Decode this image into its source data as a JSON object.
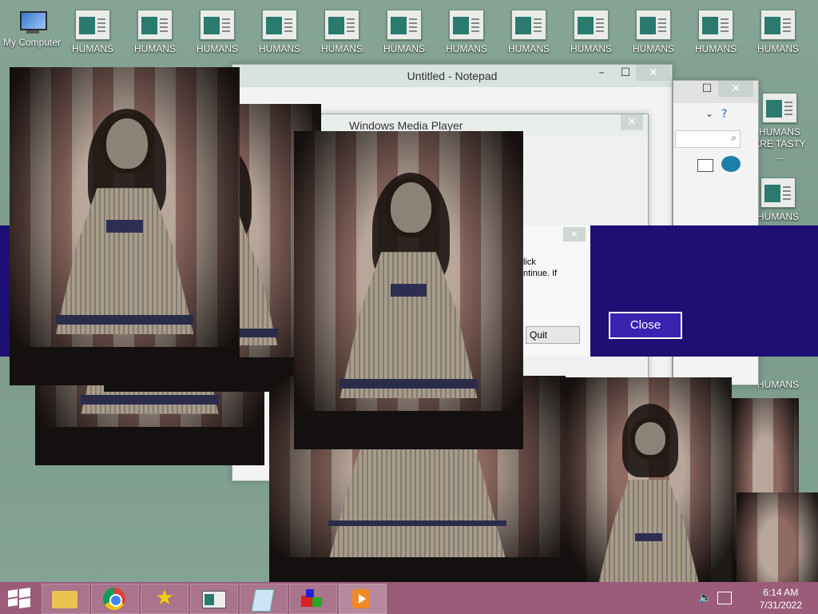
{
  "desktop": {
    "my_computer_label": "My Computer",
    "icons": [
      "HUMANS",
      "HUMANS",
      "HUMANS",
      "HUMANS",
      "HUMANS",
      "HUMANS",
      "HUMANS",
      "HUMANS",
      "HUMANS",
      "HUMANS",
      "HUMANS",
      "HUMANS"
    ],
    "right_icons": [
      "HUMANS ARE TASTY ...",
      "HUMANS ARE TASTY ...",
      "HUMANS"
    ],
    "lower_right_icon": "HUMANS"
  },
  "notepad": {
    "title": "Untitled - Notepad"
  },
  "media_player": {
    "title": "Windows Media Player"
  },
  "dialog": {
    "text_line1": "lick",
    "text_line2": "ntinue. If",
    "quit_label": "Quit"
  },
  "banner": {
    "close_label": "Close"
  },
  "taskbar": {
    "time": "6:14 AM",
    "date": "7/31/2022",
    "start_icon": "windows-start-icon",
    "pinned": [
      "file-explorer-icon",
      "chrome-icon",
      "star-icon",
      "window-app-icon",
      "notepad-icon",
      "paint-icon",
      "media-player-icon"
    ]
  }
}
